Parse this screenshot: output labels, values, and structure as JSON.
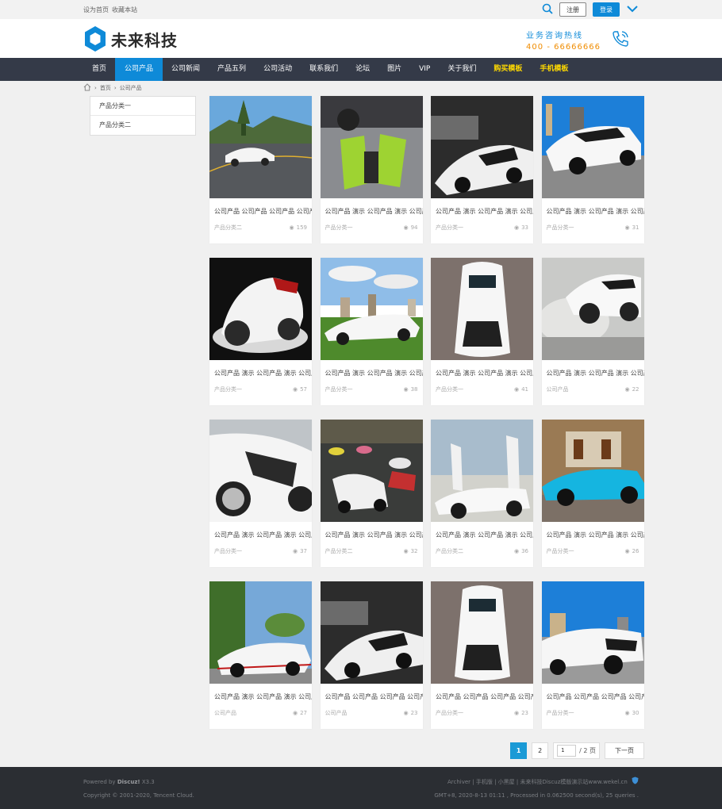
{
  "topbar": {
    "set_home": "设为首页",
    "favorite": "收藏本站",
    "register": "注册",
    "login": "登录"
  },
  "header": {
    "logo_text": "未来科技",
    "hotline_label": "业务咨询热线",
    "hotline_number": "400 - 66666666"
  },
  "nav": {
    "items": [
      "首页",
      "公司产品",
      "公司新闻",
      "产品五列",
      "公司活动",
      "联系我们",
      "论坛",
      "图片",
      "VIP",
      "关于我们",
      "购买模板",
      "手机模板"
    ]
  },
  "breadcrumb": {
    "home": "首页",
    "current": "公司产品"
  },
  "sidebar": {
    "items": [
      "产品分类一",
      "产品分类二"
    ]
  },
  "products": [
    {
      "title": "公司产品 公司产品 公司产品 公司产品",
      "category": "产品分类二",
      "views": "159"
    },
    {
      "title": "公司产品 演示 公司产品 演示 公司产品",
      "category": "产品分类一",
      "views": "94"
    },
    {
      "title": "公司产品 演示 公司产品 演示 公司产品",
      "category": "产品分类一",
      "views": "33"
    },
    {
      "title": "公司产品 演示 公司产品 演示 公司产品",
      "category": "产品分类一",
      "views": "31"
    },
    {
      "title": "公司产品 演示 公司产品 演示 公司产品",
      "category": "产品分类一",
      "views": "57"
    },
    {
      "title": "公司产品 演示 公司产品 演示 公司产品",
      "category": "产品分类一",
      "views": "38"
    },
    {
      "title": "公司产品 演示 公司产品 演示 公司产品",
      "category": "产品分类一",
      "views": "41"
    },
    {
      "title": "公司产品 演示 公司产品 演示 公司产品",
      "category": "公司产品",
      "views": "22"
    },
    {
      "title": "公司产品 演示 公司产品 演示 公司产品",
      "category": "产品分类一",
      "views": "37"
    },
    {
      "title": "公司产品 演示 公司产品 演示 公司产品",
      "category": "产品分类二",
      "views": "32"
    },
    {
      "title": "公司产品 演示 公司产品 演示 公司产品",
      "category": "产品分类二",
      "views": "36"
    },
    {
      "title": "公司产品 演示 公司产品 演示 公司产品",
      "category": "产品分类一",
      "views": "26"
    },
    {
      "title": "公司产品 演示 公司产品 演示 公司产品",
      "category": "公司产品",
      "views": "27"
    },
    {
      "title": "公司产品 公司产品 公司产品 公司产品",
      "category": "公司产品",
      "views": "23"
    },
    {
      "title": "公司产品 公司产品 公司产品 公司产品",
      "category": "产品分类一",
      "views": "23"
    },
    {
      "title": "公司产品 公司产品 公司产品 公司产品",
      "category": "产品分类一",
      "views": "30"
    }
  ],
  "pager": {
    "current": "1",
    "next_page_num": "2",
    "input_value": "1",
    "total": "/ 2 页",
    "next": "下一页"
  },
  "footer": {
    "powered_prefix": "Powered by",
    "powered_name": "Discuz!",
    "powered_version": "X3.3",
    "copyright": "Copyright © 2001-2020, Tencent Cloud.",
    "links": "Archiver | 手机版 | 小黑屋 | 未来科技Discuz模版演示站www.wekel.cn",
    "stats": "GMT+8, 2020-8-13 01:11 , Processed in 0.062500 second(s), 25 queries ."
  },
  "colors": {
    "accent": "#0e8ad8",
    "nav_bg": "#343a48",
    "footer_bg": "#2b2e33",
    "hotline_number": "#f08c00",
    "nav_highlight": "#ffd900"
  }
}
